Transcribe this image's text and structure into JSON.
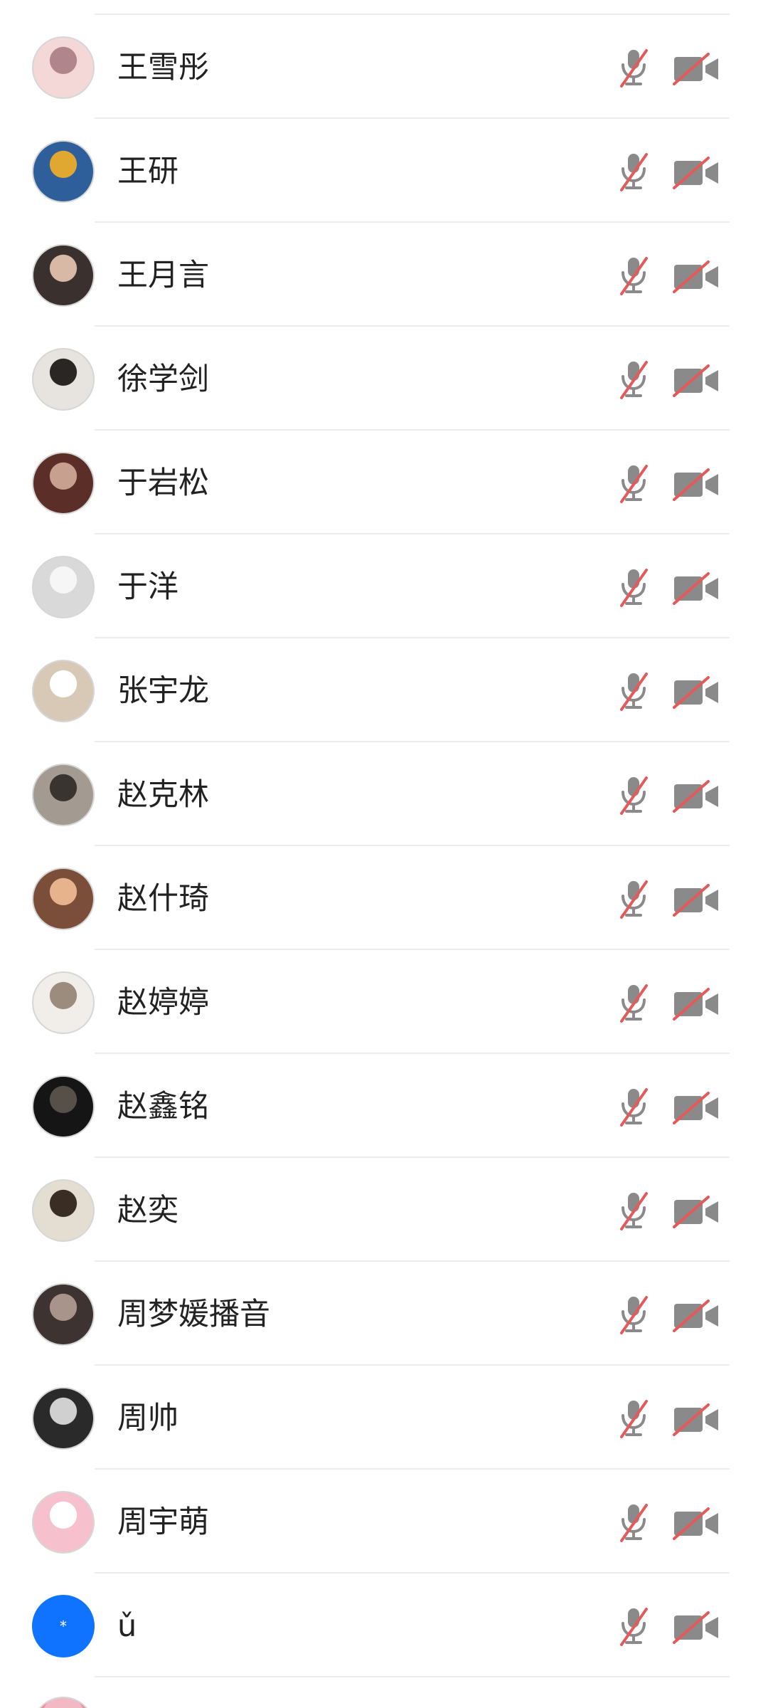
{
  "participants": [
    {
      "name": "王雪彤",
      "avatar": {
        "bg": "#f4d7d7",
        "fg": "#b0868c"
      },
      "mic": "muted-mic-icon",
      "camera": "video-off-icon"
    },
    {
      "name": "王研",
      "avatar": {
        "bg": "#2f5f9b",
        "fg": "#e0a830"
      },
      "mic": "muted-mic-icon",
      "camera": "video-off-icon"
    },
    {
      "name": "王月言",
      "avatar": {
        "bg": "#3a302e",
        "fg": "#d7b9a6"
      },
      "mic": "muted-mic-icon",
      "camera": "video-off-icon"
    },
    {
      "name": "徐学剑",
      "avatar": {
        "bg": "#e7e3df",
        "fg": "#2a2624"
      },
      "mic": "muted-mic-icon",
      "camera": "video-off-icon"
    },
    {
      "name": "于岩松",
      "avatar": {
        "bg": "#5b2f28",
        "fg": "#c8a08f"
      },
      "mic": "muted-mic-icon",
      "camera": "video-off-icon"
    },
    {
      "name": "于洋",
      "avatar": {
        "bg": "#d9d9d9",
        "fg": "#f6f6f6"
      },
      "mic": "muted-mic-icon",
      "camera": "video-off-icon"
    },
    {
      "name": "张宇龙",
      "avatar": {
        "bg": "#d8c9b6",
        "fg": "#ffffff"
      },
      "mic": "muted-mic-icon",
      "camera": "video-off-icon"
    },
    {
      "name": "赵克林",
      "avatar": {
        "bg": "#a39a92",
        "fg": "#3a3430"
      },
      "mic": "muted-mic-icon",
      "camera": "video-off-icon"
    },
    {
      "name": "赵什琦",
      "avatar": {
        "bg": "#7a4e38",
        "fg": "#e6b38d"
      },
      "mic": "muted-mic-icon",
      "camera": "video-off-icon"
    },
    {
      "name": "赵婷婷",
      "avatar": {
        "bg": "#f1eee9",
        "fg": "#9c8c7d"
      },
      "mic": "muted-mic-icon",
      "camera": "video-off-icon"
    },
    {
      "name": "赵鑫铭",
      "avatar": {
        "bg": "#151515",
        "fg": "#565049"
      },
      "mic": "muted-mic-icon",
      "camera": "video-off-icon"
    },
    {
      "name": "赵奕",
      "avatar": {
        "bg": "#e4ddd2",
        "fg": "#3a2e24"
      },
      "mic": "muted-mic-icon",
      "camera": "video-off-icon"
    },
    {
      "name": "周梦媛播音",
      "avatar": {
        "bg": "#3d3330",
        "fg": "#a8948a"
      },
      "mic": "muted-mic-icon",
      "camera": "video-off-icon"
    },
    {
      "name": "周帅",
      "avatar": {
        "bg": "#2a2a2a",
        "fg": "#d0d0d0"
      },
      "mic": "muted-mic-icon",
      "camera": "video-off-icon"
    },
    {
      "name": "周宇萌",
      "avatar": {
        "bg": "#f6c1cc",
        "fg": "#ffffff"
      },
      "mic": "muted-mic-icon",
      "camera": "video-off-icon"
    },
    {
      "name": "ǔ",
      "avatar": {
        "bg": "#0f73ff",
        "fg": "#ffffff",
        "text": "*"
      },
      "mic": "muted-mic-icon",
      "camera": "video-off-icon"
    }
  ],
  "colors": {
    "icon_gray": "#8a8a8a",
    "strike_red": "#e45a5a",
    "divider": "#ececec",
    "name_text": "#222222"
  }
}
